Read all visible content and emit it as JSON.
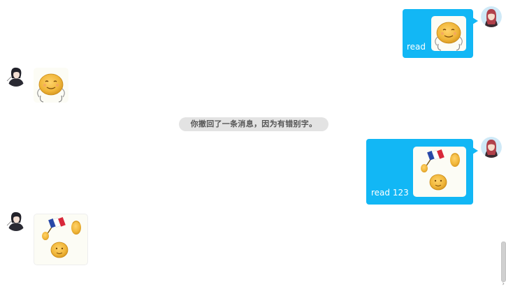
{
  "chat": {
    "messages": [
      {
        "side": "right",
        "label": "read",
        "sticker": "smiling-dough-icon",
        "avatar": "user-avatar-icon"
      },
      {
        "side": "left",
        "sticker": "smiling-dough-icon",
        "avatar": "contact-avatar-icon"
      },
      {
        "side": "system",
        "text": "你撤回了一条消息，因为有错别字。"
      },
      {
        "side": "right",
        "label": "read 123",
        "sticker": "flag-waving-dough-icon",
        "avatar": "user-avatar-icon"
      },
      {
        "side": "left",
        "sticker": "flag-waving-dough-icon",
        "avatar": "contact-avatar-icon"
      }
    ]
  },
  "colors": {
    "outgoing_bubble": "#12b7f5",
    "system_pill": "#e3e3e3"
  }
}
